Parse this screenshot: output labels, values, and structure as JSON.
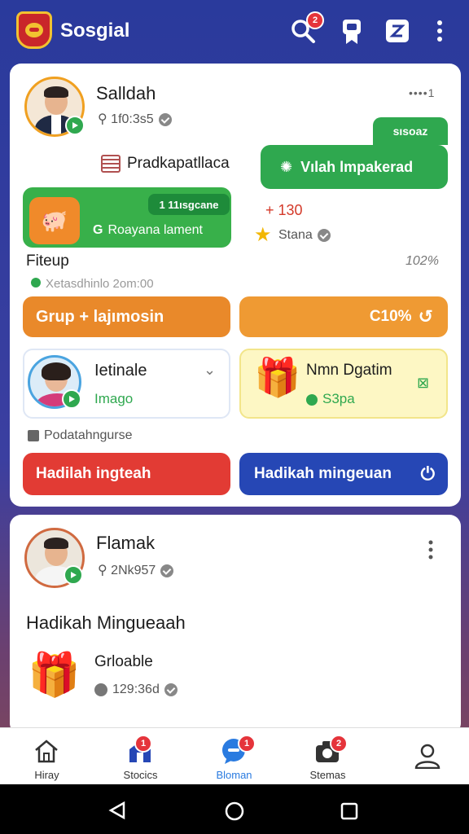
{
  "app": {
    "title": "Sosgial",
    "search_badge": "2"
  },
  "card1": {
    "profile_name": "Salldah",
    "profile_stat": "1f0:3s5",
    "menu_dots": "••••1",
    "label_chip": "Pradkapatllaca",
    "green_tag": "sısoaz",
    "green_button": "Vılah lmpakerad",
    "promo_tag": "1 11ısgcane",
    "promo_text": "Roayana lament",
    "points": "+ 130",
    "points_label": "Stana",
    "section_title": "Fiteup",
    "section_sub": "Xetasdhinlo 2om:00",
    "section_right": "102%",
    "orange_left": "Grup + lajımosin",
    "orange_right": "C10% ",
    "friend_name": "Ietinale",
    "friend_sub": "Imago",
    "gift_name": "Nmn Dgatim",
    "gift_sub": "S3pa",
    "footer_label": "Podatahngurse",
    "red_button": "Hadilah ingteah",
    "blue_button": "Hadikah mingeuan"
  },
  "card2": {
    "profile_name": "Flamak",
    "profile_stat": "2Nk957",
    "heading": "Hadikah Mingueaah",
    "item_name": "Grloable",
    "item_stat": "129:36d"
  },
  "nav": [
    {
      "label": "Hiray",
      "badge": ""
    },
    {
      "label": "Stocics",
      "badge": "1"
    },
    {
      "label": "Bloman",
      "badge": "1"
    },
    {
      "label": "Stemas",
      "badge": "2"
    },
    {
      "label": "",
      "badge": ""
    }
  ],
  "colors": {
    "green": "#2fa84f",
    "orange": "#e9892a",
    "red": "#e23b34",
    "blue": "#2647b5",
    "yellow_card": "#fdf7c4"
  }
}
